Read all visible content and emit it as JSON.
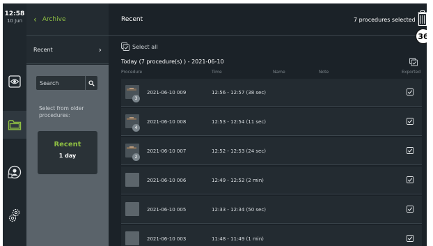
{
  "status": {
    "time": "12:58",
    "date": "10 Jun"
  },
  "nav": {
    "back_label": "Archive",
    "recent_label": "Recent"
  },
  "filter": {
    "search_placeholder": "Search",
    "older_label": "Select from older procedures:",
    "recent_card_title": "Recent",
    "recent_card_sub": "1 day"
  },
  "main": {
    "title": "Recent",
    "selected_text": "7 procedures selected",
    "badge": "36",
    "select_all": "Select all",
    "day_title": "Today (7 procedure(s) ) - 2021-06-10"
  },
  "table": {
    "headers": [
      "Procedure",
      "Time",
      "Name",
      "Note",
      "Exported"
    ],
    "rows": [
      {
        "procedure": "2021-06-10 009",
        "time": "12:56 - 12:57 (38 sec)",
        "count": "3",
        "exported": true
      },
      {
        "procedure": "2021-06-10 008",
        "time": "12:53 - 12:54 (11 sec)",
        "count": "4",
        "exported": true
      },
      {
        "procedure": "2021-06-10 007",
        "time": "12:52 - 12:53 (24 sec)",
        "count": "2",
        "exported": true
      },
      {
        "procedure": "2021-06-10 006",
        "time": "12:49 - 12:52 (2 min)",
        "count": "",
        "exported": true
      },
      {
        "procedure": "2021-06-10 005",
        "time": "12:33 - 12:34 (50 sec)",
        "count": "",
        "exported": true
      },
      {
        "procedure": "2021-06-10 003",
        "time": "11:48 - 11:49 (1 min)",
        "count": "",
        "exported": true
      }
    ]
  },
  "icons": {
    "rail": [
      "eye-icon",
      "folder-icon",
      "user-icon",
      "gear-icon"
    ],
    "header": [
      "trash-icon"
    ]
  },
  "colors": {
    "accent": "#8fc043",
    "background": "#1b2228",
    "panel": "#5a636a"
  }
}
